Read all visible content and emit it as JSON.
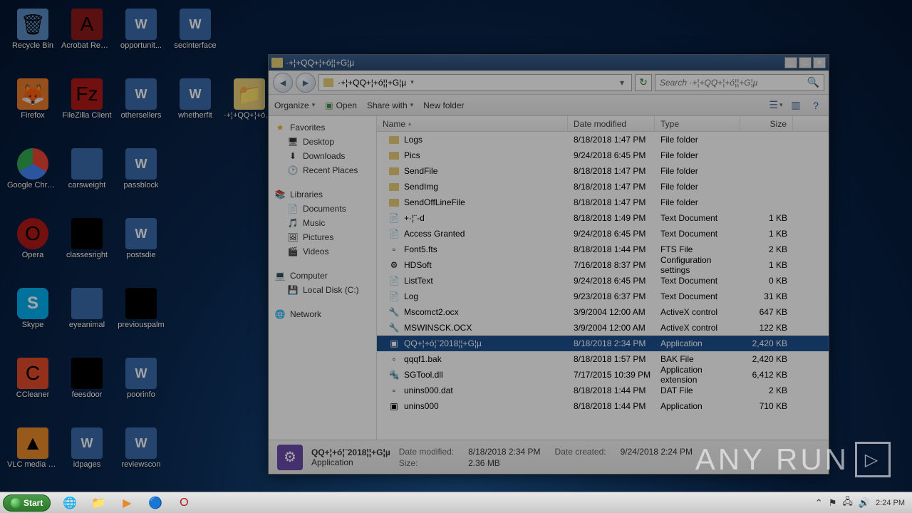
{
  "desktop": {
    "icons": [
      {
        "label": "Recycle Bin",
        "cls": "ic-recycle",
        "glyph": "🗑"
      },
      {
        "label": "Acrobat Reader DC",
        "cls": "ic-acrobat",
        "glyph": "A"
      },
      {
        "label": "opportunit...",
        "cls": "ic-word",
        "glyph": "W"
      },
      {
        "label": "secinterface",
        "cls": "ic-word",
        "glyph": "W"
      },
      {
        "label": "",
        "cls": "",
        "glyph": ""
      },
      {
        "label": "Firefox",
        "cls": "ic-firefox",
        "glyph": "🦊"
      },
      {
        "label": "FileZilla Client",
        "cls": "ic-filezilla",
        "glyph": "Fz"
      },
      {
        "label": "othersellers",
        "cls": "ic-word",
        "glyph": "W"
      },
      {
        "label": "whetherfit",
        "cls": "ic-word",
        "glyph": "W"
      },
      {
        "label": "·+¦+QQ+¦+ó¦¦+G¦µ",
        "cls": "ic-folder-desk",
        "glyph": "📁"
      },
      {
        "label": "Google Chrome",
        "cls": "ic-chrome",
        "glyph": ""
      },
      {
        "label": "carsweight",
        "cls": "ic-word",
        "glyph": ""
      },
      {
        "label": "passblock",
        "cls": "ic-word",
        "glyph": "W"
      },
      {
        "label": "",
        "cls": "",
        "glyph": ""
      },
      {
        "label": "",
        "cls": "",
        "glyph": ""
      },
      {
        "label": "Opera",
        "cls": "ic-opera",
        "glyph": "O"
      },
      {
        "label": "classesright",
        "cls": "ic-black",
        "glyph": ""
      },
      {
        "label": "postsdie",
        "cls": "ic-word",
        "glyph": "W"
      },
      {
        "label": "",
        "cls": "",
        "glyph": ""
      },
      {
        "label": "",
        "cls": "",
        "glyph": ""
      },
      {
        "label": "Skype",
        "cls": "ic-skype",
        "glyph": "S"
      },
      {
        "label": "eyeanimal",
        "cls": "ic-word",
        "glyph": ""
      },
      {
        "label": "previouspalm",
        "cls": "ic-black",
        "glyph": ""
      },
      {
        "label": "",
        "cls": "",
        "glyph": ""
      },
      {
        "label": "",
        "cls": "",
        "glyph": ""
      },
      {
        "label": "CCleaner",
        "cls": "ic-ccleaner",
        "glyph": "C"
      },
      {
        "label": "feesdoor",
        "cls": "ic-black",
        "glyph": ""
      },
      {
        "label": "poorinfo",
        "cls": "ic-word",
        "glyph": "W"
      },
      {
        "label": "",
        "cls": "",
        "glyph": ""
      },
      {
        "label": "",
        "cls": "",
        "glyph": ""
      },
      {
        "label": "VLC media player",
        "cls": "ic-vlc",
        "glyph": "▲"
      },
      {
        "label": "idpages",
        "cls": "ic-word",
        "glyph": "W"
      },
      {
        "label": "reviewscon",
        "cls": "ic-word",
        "glyph": "W"
      }
    ]
  },
  "explorer": {
    "title": "·+¦+QQ+¦+ó¦¦+G¦µ",
    "address": "·+¦+QQ+¦+ó¦¦+G¦µ",
    "search_placeholder": "Search ·+¦+QQ+¦+ó¦¦+G¦µ",
    "toolbar": {
      "organize": "Organize",
      "open": "Open",
      "share": "Share with",
      "newfolder": "New folder"
    },
    "navpane": {
      "favorites": {
        "label": "Favorites",
        "items": [
          "Desktop",
          "Downloads",
          "Recent Places"
        ]
      },
      "libraries": {
        "label": "Libraries",
        "items": [
          "Documents",
          "Music",
          "Pictures",
          "Videos"
        ]
      },
      "computer": {
        "label": "Computer",
        "items": [
          "Local Disk (C:)"
        ]
      },
      "network": {
        "label": "Network"
      }
    },
    "columns": {
      "name": "Name",
      "date": "Date modified",
      "type": "Type",
      "size": "Size"
    },
    "files": [
      {
        "name": "Logs",
        "date": "8/18/2018 1:47 PM",
        "type": "File folder",
        "size": "",
        "icon": "folder"
      },
      {
        "name": "Pics",
        "date": "9/24/2018 6:45 PM",
        "type": "File folder",
        "size": "",
        "icon": "folder"
      },
      {
        "name": "SendFile",
        "date": "8/18/2018 1:47 PM",
        "type": "File folder",
        "size": "",
        "icon": "folder"
      },
      {
        "name": "SendImg",
        "date": "8/18/2018 1:47 PM",
        "type": "File folder",
        "size": "",
        "icon": "folder"
      },
      {
        "name": "SendOffLineFile",
        "date": "8/18/2018 1:47 PM",
        "type": "File folder",
        "size": "",
        "icon": "folder"
      },
      {
        "name": "+·¦¨-d",
        "date": "8/18/2018 1:49 PM",
        "type": "Text Document",
        "size": "1 KB",
        "icon": "txt"
      },
      {
        "name": "Access Granted",
        "date": "9/24/2018 6:45 PM",
        "type": "Text Document",
        "size": "1 KB",
        "icon": "txt"
      },
      {
        "name": "Font5.fts",
        "date": "8/18/2018 1:44 PM",
        "type": "FTS File",
        "size": "2 KB",
        "icon": "file"
      },
      {
        "name": "HDSoft",
        "date": "7/16/2018 8:37 PM",
        "type": "Configuration settings",
        "size": "1 KB",
        "icon": "cfg"
      },
      {
        "name": "ListText",
        "date": "9/24/2018 6:45 PM",
        "type": "Text Document",
        "size": "0 KB",
        "icon": "txt"
      },
      {
        "name": "Log",
        "date": "9/23/2018 6:37 PM",
        "type": "Text Document",
        "size": "31 KB",
        "icon": "txt"
      },
      {
        "name": "Mscomct2.ocx",
        "date": "3/9/2004 12:00 AM",
        "type": "ActiveX control",
        "size": "647 KB",
        "icon": "ocx"
      },
      {
        "name": "MSWINSCK.OCX",
        "date": "3/9/2004 12:00 AM",
        "type": "ActiveX control",
        "size": "122 KB",
        "icon": "ocx"
      },
      {
        "name": "QQ+¦+ó¦¨2018¦¦+G¦µ",
        "date": "8/18/2018 2:34 PM",
        "type": "Application",
        "size": "2,420 KB",
        "icon": "app",
        "selected": true
      },
      {
        "name": "qqqf1.bak",
        "date": "8/18/2018 1:57 PM",
        "type": "BAK File",
        "size": "2,420 KB",
        "icon": "file"
      },
      {
        "name": "SGTool.dll",
        "date": "7/17/2015 10:39 PM",
        "type": "Application extension",
        "size": "6,412 KB",
        "icon": "dll"
      },
      {
        "name": "unins000.dat",
        "date": "8/18/2018 1:44 PM",
        "type": "DAT File",
        "size": "2 KB",
        "icon": "file"
      },
      {
        "name": "unins000",
        "date": "8/18/2018 1:44 PM",
        "type": "Application",
        "size": "710 KB",
        "icon": "app"
      }
    ],
    "details": {
      "name": "QQ+¦+ó¦¨2018¦¦+G¦µ",
      "type": "Application",
      "datemod_lbl": "Date modified:",
      "datemod": "8/18/2018 2:34 PM",
      "datecreated_lbl": "Date created:",
      "datecreated": "9/24/2018 2:24 PM",
      "size_lbl": "Size:",
      "size": "2.36 MB"
    }
  },
  "taskbar": {
    "start": "Start",
    "clock": "2:24 PM"
  },
  "watermark": "ANY      RUN"
}
